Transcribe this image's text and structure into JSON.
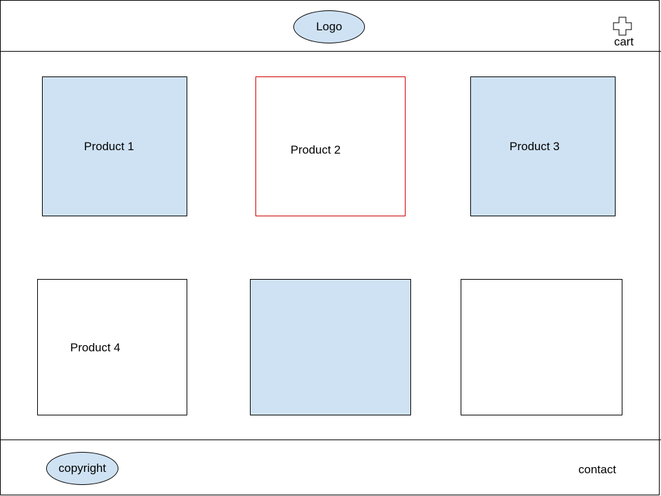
{
  "header": {
    "logo_label": "Logo",
    "cart_label": "cart",
    "cart_icon": "plus-icon"
  },
  "products": [
    {
      "label": "Product 1",
      "fill": "#cfe2f3",
      "selected": false
    },
    {
      "label": "Product 2",
      "fill": "#ffffff",
      "selected": true
    },
    {
      "label": "Product 3",
      "fill": "#cfe2f3",
      "selected": false
    },
    {
      "label": "Product 4",
      "fill": "#ffffff",
      "selected": false
    },
    {
      "label": "",
      "fill": "#cfe2f3",
      "selected": false
    },
    {
      "label": "",
      "fill": "#ffffff",
      "selected": false
    }
  ],
  "footer": {
    "copyright_label": "copyright",
    "contact_label": "contact"
  },
  "colors": {
    "tile_blue": "#cfe2f3",
    "selected_border": "#cc0000",
    "border": "#000000"
  }
}
